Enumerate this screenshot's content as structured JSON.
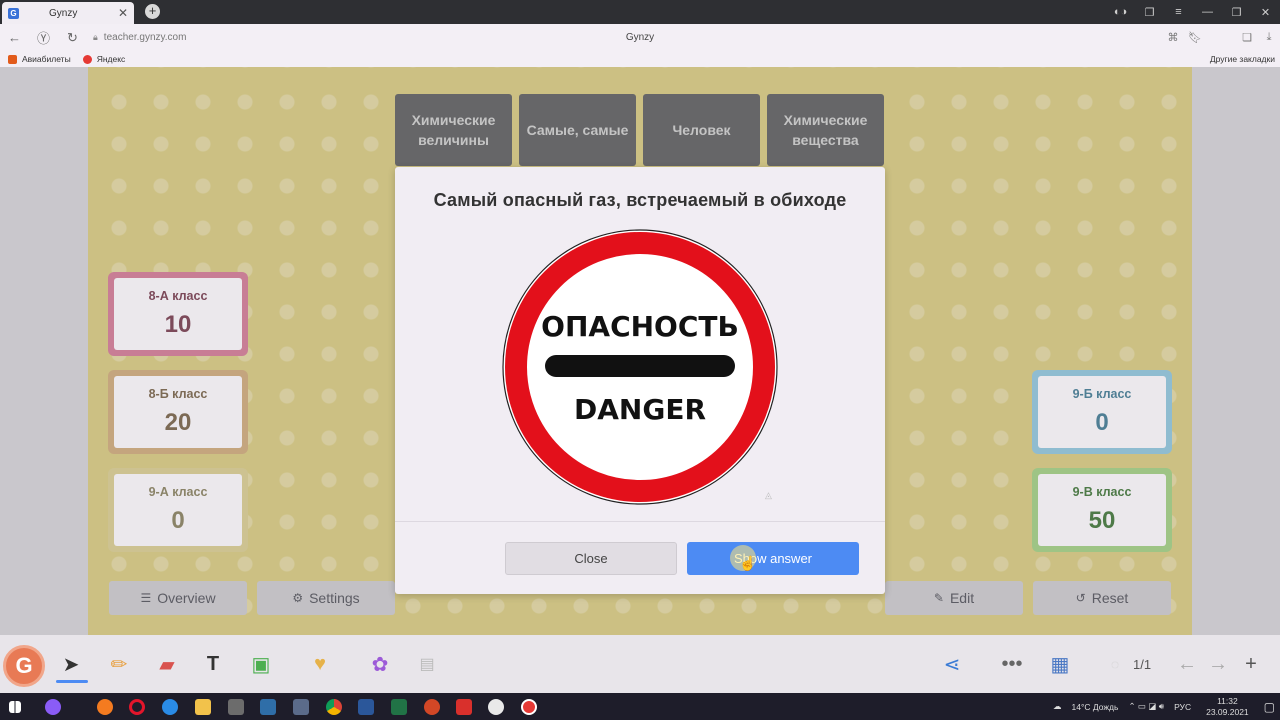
{
  "browser": {
    "tab_title": "Gynzy",
    "tab_favicon": "G",
    "url": "teacher.gynzy.com",
    "page_title": "Gynzy",
    "bookmarks": [
      {
        "label": "Авиабилеты",
        "color": "#e25b1b"
      },
      {
        "label": "Яндекс",
        "color": "#e53935"
      }
    ],
    "other_bookmarks": "Другие закладки"
  },
  "categories": [
    "Химические величины",
    "Самые, самые",
    "Человек",
    "Химические вещества"
  ],
  "teams": [
    {
      "name": "8-А класс",
      "score": "10",
      "border": "#c87d95",
      "color": "#7c4a5a"
    },
    {
      "name": "8-Б класс",
      "score": "20",
      "border": "#c4a57e",
      "color": "#7c6a55"
    },
    {
      "name": "9-А класс",
      "score": "0",
      "border": "#cdc291",
      "color": "#8a8368"
    },
    {
      "name": "9-Б класс",
      "score": "0",
      "border": "#8fbcd0",
      "color": "#4f7e94"
    },
    {
      "name": "9-В класс",
      "score": "50",
      "border": "#9ec485",
      "color": "#4e7a48"
    }
  ],
  "controls": {
    "overview": "Overview",
    "settings": "Settings",
    "edit": "Edit",
    "reset": "Reset"
  },
  "modal": {
    "question": "Самый опасный газ, встречаемый в обиходе",
    "sign_top": "ОПАСНОСТЬ",
    "sign_bottom": "DANGER",
    "close_label": "Close",
    "answer_label": "Show answer"
  },
  "toolbar": {
    "logo": "G",
    "page_indicator": "1/1"
  },
  "taskbar": {
    "weather": "14°C Дождь",
    "lang": "РУС",
    "time": "11:32",
    "date": "23.09.2021"
  }
}
